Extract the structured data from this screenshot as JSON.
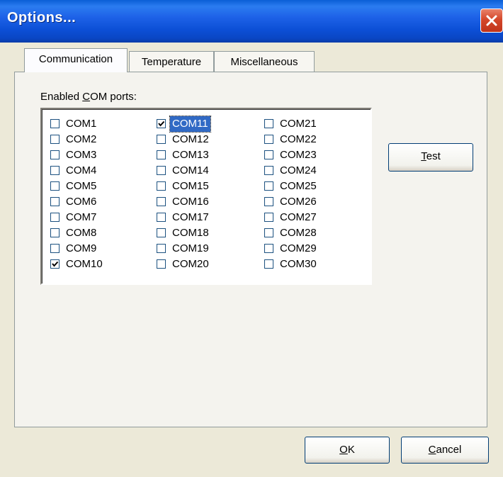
{
  "window": {
    "title": "Options...",
    "close_icon": "close-icon"
  },
  "tabs": [
    {
      "label": "Communication",
      "active": true
    },
    {
      "label": "Temperature",
      "active": false
    },
    {
      "label": "Miscellaneous",
      "active": false
    }
  ],
  "communication": {
    "ports_label_prefix": "Enabled ",
    "ports_label_accel": "C",
    "ports_label_rest": "OM ports:",
    "ports": [
      {
        "label": "COM1",
        "checked": false
      },
      {
        "label": "COM2",
        "checked": false
      },
      {
        "label": "COM3",
        "checked": false
      },
      {
        "label": "COM4",
        "checked": false
      },
      {
        "label": "COM5",
        "checked": false
      },
      {
        "label": "COM6",
        "checked": false
      },
      {
        "label": "COM7",
        "checked": false
      },
      {
        "label": "COM8",
        "checked": false
      },
      {
        "label": "COM9",
        "checked": false
      },
      {
        "label": "COM10",
        "checked": true
      },
      {
        "label": "COM11",
        "checked": true,
        "focused": true
      },
      {
        "label": "COM12",
        "checked": false
      },
      {
        "label": "COM13",
        "checked": false
      },
      {
        "label": "COM14",
        "checked": false
      },
      {
        "label": "COM15",
        "checked": false
      },
      {
        "label": "COM16",
        "checked": false
      },
      {
        "label": "COM17",
        "checked": false
      },
      {
        "label": "COM18",
        "checked": false
      },
      {
        "label": "COM19",
        "checked": false
      },
      {
        "label": "COM20",
        "checked": false
      },
      {
        "label": "COM21",
        "checked": false
      },
      {
        "label": "COM22",
        "checked": false
      },
      {
        "label": "COM23",
        "checked": false
      },
      {
        "label": "COM24",
        "checked": false
      },
      {
        "label": "COM25",
        "checked": false
      },
      {
        "label": "COM26",
        "checked": false
      },
      {
        "label": "COM27",
        "checked": false
      },
      {
        "label": "COM28",
        "checked": false
      },
      {
        "label": "COM29",
        "checked": false
      },
      {
        "label": "COM30",
        "checked": false
      }
    ],
    "test_button": {
      "accel": "T",
      "rest": "est"
    }
  },
  "buttons": {
    "ok": {
      "accel": "O",
      "rest": "K"
    },
    "cancel": {
      "accel": "C",
      "rest": "ancel"
    }
  },
  "colors": {
    "title_bar": "#0a5ed6",
    "dialog_bg": "#ece9d8",
    "selection": "#316ac5",
    "close_button": "#d4472a"
  }
}
